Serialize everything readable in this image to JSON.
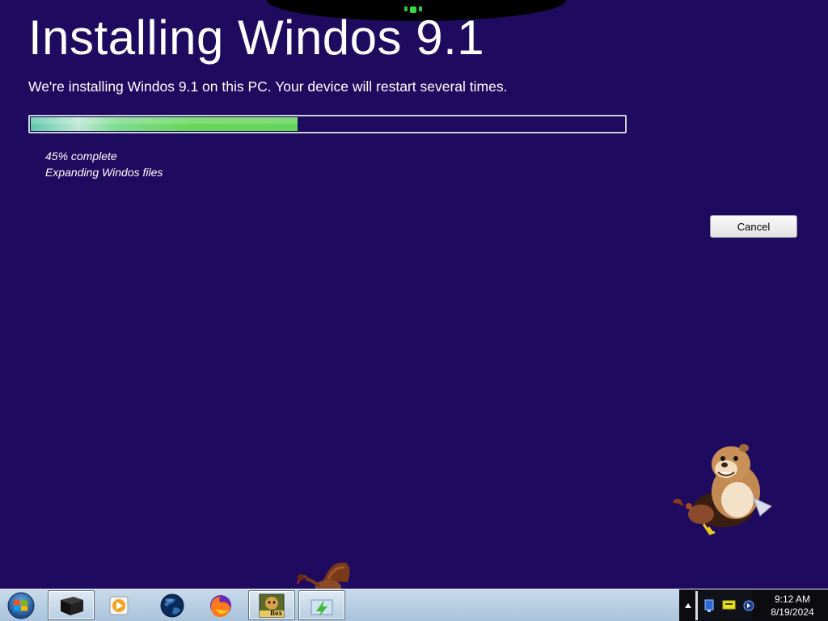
{
  "installer": {
    "title": "Installing Windos 9.1",
    "subtitle": "We're installing Windos 9.1 on this PC. Your device will restart several times.",
    "progress_fraction": 0.45,
    "percent_text": "45% complete",
    "status_text": "Expanding Windos files",
    "cancel_label": "Cancel"
  },
  "taskbar": {
    "start_icon": "windows-orb-icon",
    "items": [
      {
        "name": "black-box-app-icon",
        "active": true
      },
      {
        "name": "media-player-icon",
        "active": false
      },
      {
        "name": "globe-app-icon",
        "active": false
      },
      {
        "name": "firefox-icon",
        "active": false
      },
      {
        "name": "box-app-icon",
        "label": "Box",
        "active": true
      },
      {
        "name": "green-arrow-app-icon",
        "active": true
      }
    ],
    "clock": {
      "time": "9:12 AM",
      "date": "8/19/2024"
    }
  },
  "colors": {
    "background": "#1e0a5e",
    "progress_fill": "#62d45a",
    "taskbar": "#b9cfe3",
    "tray": "#0c0c10"
  }
}
